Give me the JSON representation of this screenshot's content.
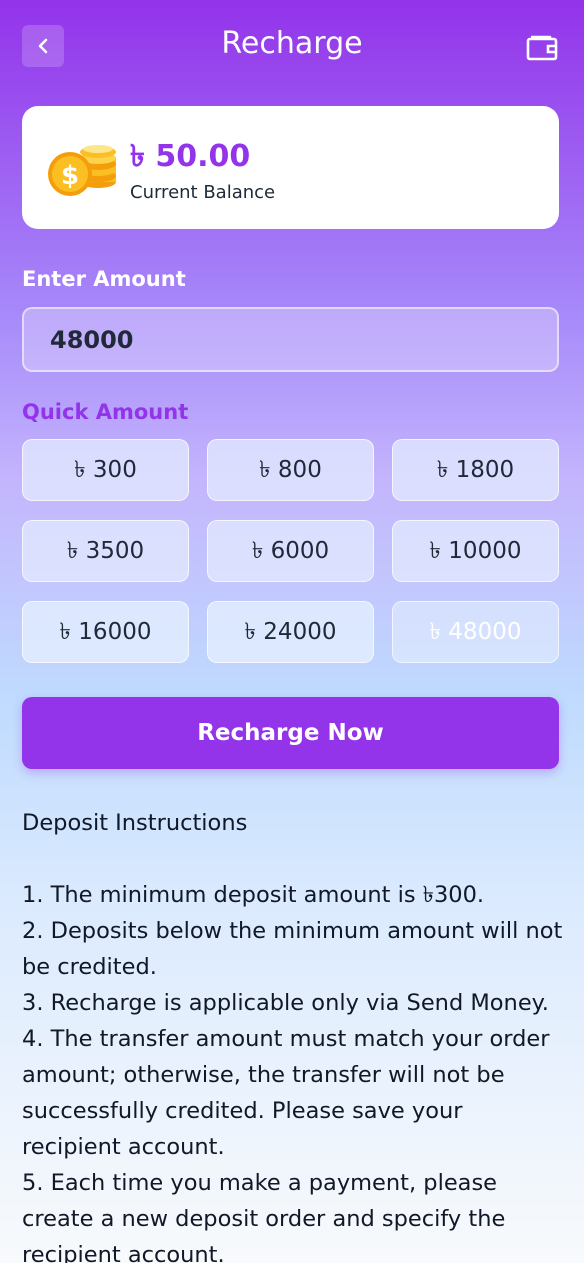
{
  "header": {
    "title": "Recharge",
    "back_icon": "chevron-left-icon",
    "wallet_icon": "wallet-icon"
  },
  "balance": {
    "amount": "৳ 50.00",
    "label": "Current Balance",
    "icon": "coins-icon"
  },
  "amount_input": {
    "label": "Enter Amount",
    "value": "48000"
  },
  "quick_amount": {
    "label": "Quick Amount",
    "options": [
      "৳ 300",
      "৳ 800",
      "৳ 1800",
      "৳ 3500",
      "৳ 6000",
      "৳ 10000",
      "৳ 16000",
      "৳ 24000",
      "৳ 48000"
    ],
    "selected": "৳ 48000"
  },
  "recharge_button": "Recharge Now",
  "instructions": {
    "heading": "Deposit Instructions",
    "items": [
      "1. The minimum deposit amount is ৳300.",
      "2. Deposits below the minimum amount will not be credited.",
      "3. Recharge is applicable only via Send Money.",
      "4. The transfer amount must match your order amount; otherwise, the transfer will not be successfully credited. Please save your recipient account.",
      "5. Each time you make a payment, please create a new deposit order and specify the recipient account."
    ]
  },
  "colors": {
    "accent": "#9333ea",
    "coin": "#fbbf24"
  }
}
